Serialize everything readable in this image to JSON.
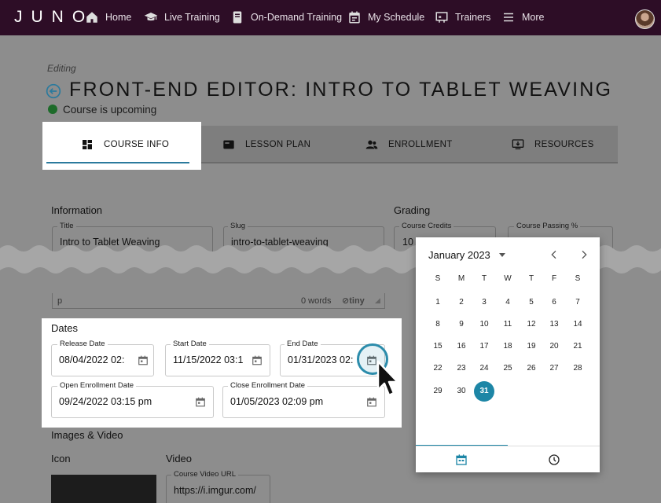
{
  "nav": {
    "logo": "JUNO",
    "items": [
      {
        "label": "Home",
        "icon": "home-icon"
      },
      {
        "label": "Live Training",
        "icon": "graduation-cap-icon"
      },
      {
        "label": "On-Demand Training",
        "icon": "book-icon"
      },
      {
        "label": "My Schedule",
        "icon": "calendar-icon"
      },
      {
        "label": "Trainers",
        "icon": "presentation-icon"
      },
      {
        "label": "More",
        "icon": "menu-icon"
      }
    ]
  },
  "header": {
    "editing_label": "Editing",
    "title": "FRONT-END EDITOR: INTRO TO TABLET WEAVING",
    "status": "Course is upcoming",
    "status_color": "#1d6b2a"
  },
  "tabs": [
    {
      "label": "COURSE INFO",
      "icon": "dashboard-icon",
      "active": true
    },
    {
      "label": "LESSON PLAN",
      "icon": "card-icon",
      "active": false
    },
    {
      "label": "ENROLLMENT",
      "icon": "people-icon",
      "active": false
    },
    {
      "label": "RESOURCES",
      "icon": "download-icon",
      "active": false
    }
  ],
  "information": {
    "heading": "Information",
    "title_label": "Title",
    "title_value": "Intro to Tablet Weaving",
    "slug_label": "Slug",
    "slug_value": "intro-to-tablet-weaving",
    "editor_path": "p",
    "editor_words": "0 words",
    "editor_brand": "tiny"
  },
  "grading": {
    "heading": "Grading",
    "credits_label": "Course Credits",
    "credits_value": "10",
    "passing_label": "Course Passing %"
  },
  "dates": {
    "heading": "Dates",
    "release_label": "Release Date",
    "release_value": "08/04/2022 02:",
    "start_label": "Start Date",
    "start_value": "11/15/2022 03:1",
    "end_label": "End Date",
    "end_value": "01/31/2023 02:",
    "open_label": "Open Enrollment Date",
    "open_value": "09/24/2022 03:15 pm",
    "close_label": "Close Enrollment Date",
    "close_value": "01/05/2023 02:09 pm"
  },
  "media": {
    "heading": "Images & Video",
    "icon_label": "Icon",
    "video_label": "Video",
    "video_url_label": "Course Video URL",
    "video_url_value": "https://i.imgur.com/"
  },
  "calendar": {
    "month_label": "January 2023",
    "weekdays": [
      "S",
      "M",
      "T",
      "W",
      "T",
      "F",
      "S"
    ],
    "weeks": [
      [
        "1",
        "2",
        "3",
        "4",
        "5",
        "6",
        "7"
      ],
      [
        "8",
        "9",
        "10",
        "11",
        "12",
        "13",
        "14"
      ],
      [
        "15",
        "16",
        "17",
        "18",
        "19",
        "20",
        "21"
      ],
      [
        "22",
        "23",
        "24",
        "25",
        "26",
        "27",
        "28"
      ],
      [
        "29",
        "30",
        "31"
      ]
    ],
    "selected_day": "31",
    "accent_color": "#1d86a6"
  }
}
